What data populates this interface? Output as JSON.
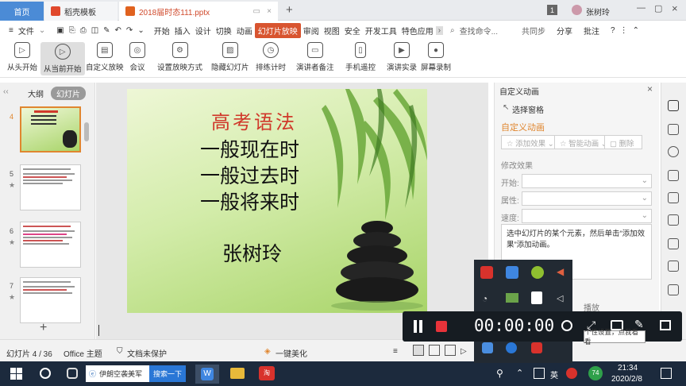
{
  "titlebar": {
    "home_tab": "首页",
    "template_tab": "稻壳模板",
    "doc_tab": "2018届时态111.pptx",
    "add_tab": "+",
    "badge_count": "1",
    "user_name": "张树玲"
  },
  "menubar": {
    "file_menu": "文件",
    "items": [
      "开始",
      "插入",
      "设计",
      "切换",
      "动画",
      "幻灯片放映",
      "审阅",
      "视图",
      "安全",
      "开发工具",
      "特色应用"
    ],
    "active_item": "幻灯片放映",
    "search_placeholder": "查找命令...",
    "collaborate": "共同步",
    "share": "分享",
    "comment": "批注"
  },
  "ribbon": {
    "buttons": [
      "从头开始",
      "从当前开始",
      "自定义放映",
      "会议",
      "设置放映方式",
      "隐藏幻灯片",
      "排练计时",
      "演讲者备注",
      "手机遥控",
      "演讲实录",
      "屏幕录制"
    ]
  },
  "leftpanel": {
    "tab_outline": "大纲",
    "tab_slides": "幻灯片",
    "slide_numbers": [
      "4",
      "5",
      "6",
      "7"
    ],
    "add_symbol": "+"
  },
  "slide": {
    "title": "高考语法",
    "line1": "一般现在时",
    "line2": "一般过去时",
    "line3": "一般将来时",
    "author": "张树玲"
  },
  "rightpanel": {
    "header": "自定义动画",
    "select_pane": "选择窗格",
    "section_title": "自定义动画",
    "add_effect": "添加效果",
    "smart_anim": "智能动画",
    "delete": "删除",
    "modify_label": "修改效果",
    "start_label": "开始:",
    "attr_label": "属性:",
    "speed_label": "速度:",
    "hint": "选中幻灯片的某个元素，然后单击“添加效果”添加动画。",
    "play_partial": "播放"
  },
  "statusbar": {
    "slide_info": "幻灯片 4 / 36",
    "theme": "Office 主题",
    "protect": "文档未保护",
    "beautify": "一键美化"
  },
  "recorder": {
    "timer": "00:00:00",
    "tooltip": "个性设置，点我看看"
  },
  "taskbar": {
    "browser_text": "伊朗空袭美军",
    "search_btn": "搜索一下",
    "time": "21:34",
    "date": "2020/2/8",
    "lang": "英",
    "badge": "74"
  },
  "colors": {
    "accent": "#d8542f",
    "slide_title": "#d0392b",
    "taskbar": "#1c2a3d",
    "recorder": "#161c22"
  }
}
